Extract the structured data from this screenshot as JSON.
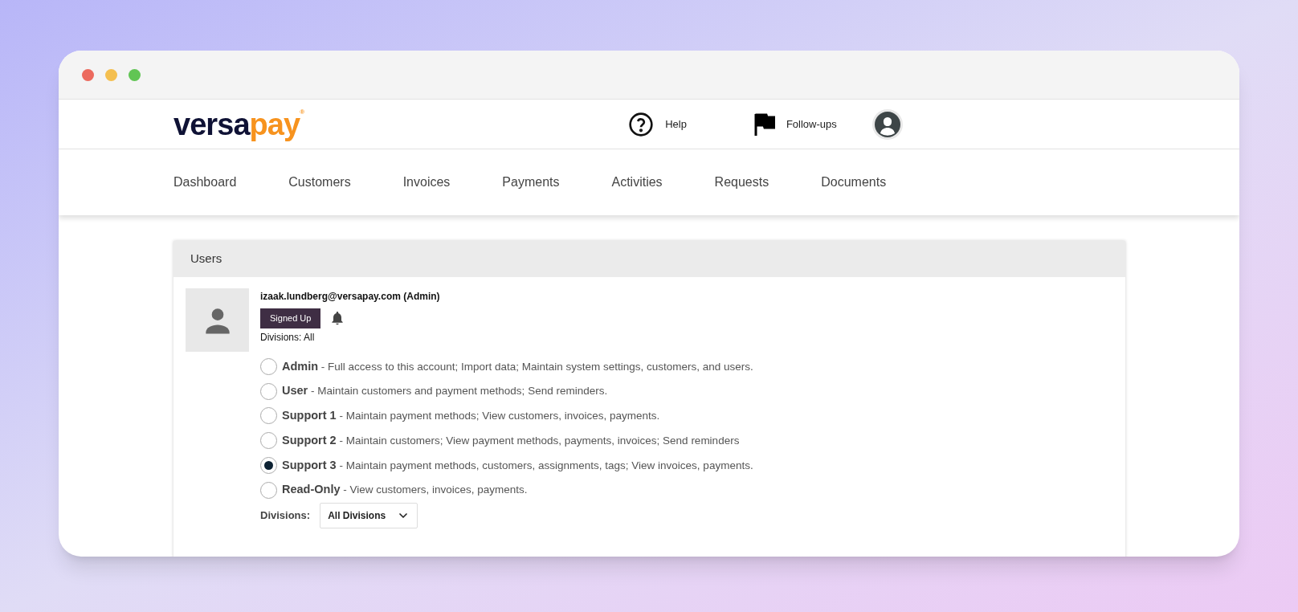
{
  "header": {
    "logo": {
      "part_1": "versa",
      "part_2": "pay",
      "mark": "®"
    },
    "links": [
      {
        "kind": "help",
        "label": "Help"
      },
      {
        "kind": "flag",
        "label": "Follow-ups"
      }
    ]
  },
  "nav": [
    {
      "label": "Dashboard"
    },
    {
      "label": "Customers"
    },
    {
      "label": "Invoices"
    },
    {
      "label": "Payments"
    },
    {
      "label": "Activities"
    },
    {
      "label": "Requests"
    },
    {
      "label": "Documents"
    }
  ],
  "panel": {
    "title": "Users",
    "user": {
      "email": "izaak.lundberg@versapay.com (Admin)",
      "status": "Signed Up",
      "divisions": "Divisions: All"
    },
    "roles": [
      {
        "name": "Admin",
        "description": " - Full access to this account; Import data; Maintain system settings, customers, and users.",
        "selected": false
      },
      {
        "name": "User",
        "description": " - Maintain customers and payment methods; Send reminders.",
        "selected": false
      },
      {
        "name": "Support 1",
        "description": " - Maintain payment methods; View customers, invoices, payments.",
        "selected": false
      },
      {
        "name": "Support 2",
        "description": " - Maintain customers; View payment methods, payments, invoices; Send reminders",
        "selected": false
      },
      {
        "name": "Support 3",
        "description": " - Maintain payment methods, customers, assignments, tags; View invoices, payments.",
        "selected": true
      },
      {
        "name": "Read-Only",
        "description": " - View customers, invoices, payments.",
        "selected": false
      }
    ],
    "divisions_label": "Divisions:",
    "divisions_select": "All Divisions"
  }
}
